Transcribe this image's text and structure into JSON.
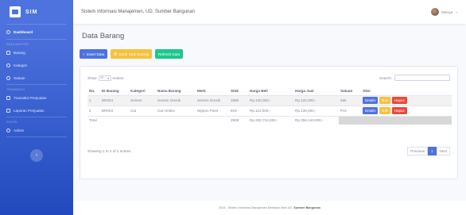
{
  "sidebar": {
    "brand": "SIM",
    "dashboard": "Dashboard",
    "section_master": "DATA MASTER",
    "barang": "Barang",
    "kategori": "Kategori",
    "satuan": "Satuan",
    "section_transaksi": "TRANSAKSI",
    "transaksi_penjualan": "Transaksi Penjualan",
    "laporan_penjualan": "Laporan Penjualan",
    "section_profil": "PROFIL",
    "admin": "Admin",
    "toggle_glyph": "‹"
  },
  "topbar": {
    "title": "Sistem Informasi Manajemen, UD. Sumber Bangunan",
    "user_name": "Meisya",
    "caret": "⌄"
  },
  "page": {
    "title": "Data Barang",
    "insert_label": "Insert Data",
    "sort_label": "Sortir Stok Kurang",
    "refresh_label": "Refresh Data"
  },
  "table": {
    "show_label": "Show",
    "length_value": "10",
    "entries_label": "entries",
    "search_label": "Search:",
    "headers": [
      "No.",
      "ID Barang",
      "Kategori",
      "Nama Barang",
      "Merk",
      "Stok",
      "Harga Beli",
      "Harga Jual",
      "Satuan",
      "Aksi"
    ],
    "rows": [
      [
        "1",
        "BR004",
        "Semen",
        "Semen Gresik",
        "Semen Gresik",
        "1990",
        "Rp.100,000,-",
        "Rp.120,000,-",
        "Zak"
      ],
      [
        "2",
        "BR003",
        "Cat",
        "Cat Vinilex",
        "Nippon Paint",
        "918",
        "Rp.113,000,-",
        "Rp.130,000,-",
        "Pcs"
      ]
    ],
    "action_details": "Details",
    "action_edit": "Edit",
    "action_delete": "Hapus",
    "total_label": "Total",
    "total_stok": "2908",
    "total_beli": "Rp.302,734,000,-",
    "total_jual": "Rp.358,140,000,-",
    "info": "Showing 1 to 2 of 2 entries",
    "prev_label": "Previous",
    "current_page": "1",
    "next_label": "Next"
  },
  "footer": {
    "text": "2024 - Sistem Informasi Manajemen Berbasis Web UD.",
    "brand": "Sumber Bangunan"
  },
  "colors": {
    "primary": "#4e73df",
    "warning": "#f6c23e",
    "success": "#1cc88a",
    "danger": "#e74a3b"
  }
}
